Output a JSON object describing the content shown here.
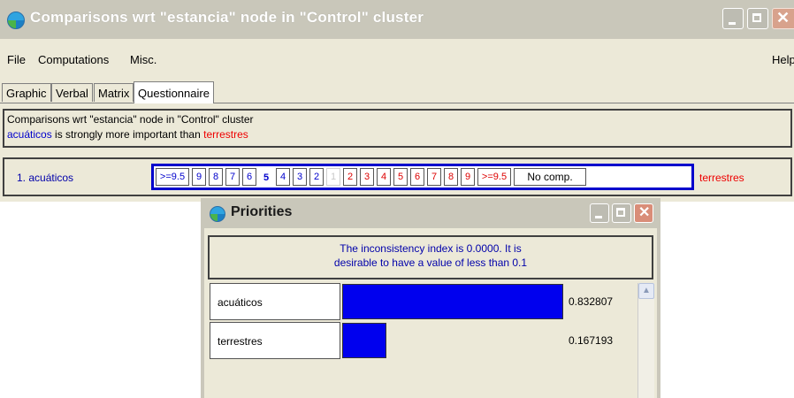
{
  "main_window": {
    "title": "Comparisons wrt \"estancia\" node in \"Control\" cluster",
    "menu": [
      "File",
      "Computations",
      "Misc.",
      "Help"
    ],
    "tabs": [
      "Graphic",
      "Verbal",
      "Matrix",
      "Questionnaire"
    ],
    "active_tab": "Questionnaire",
    "description": {
      "line1": "Comparisons wrt \"estancia\" node in \"Control\" cluster",
      "line2_left": "acuáticos",
      "line2_mid": " is strongly more important than ",
      "line2_right": "terrestres"
    },
    "question": {
      "left_label": "1.  acuáticos",
      "right_label": "terrestres",
      "scale_left": [
        ">=9.5",
        "9",
        "8",
        "7",
        "6",
        "5",
        "4",
        "3",
        "2"
      ],
      "scale_center": "1",
      "scale_right": [
        "2",
        "3",
        "4",
        "5",
        "6",
        "7",
        "8",
        "9",
        ">=9.5"
      ],
      "no_comp": "No comp.",
      "selected": "5"
    }
  },
  "priorities_window": {
    "title": "Priorities",
    "inconsistency_line1": "The inconsistency index is 0.0000.  It is",
    "inconsistency_line2": "desirable to have a value of less than 0.1",
    "rows": [
      {
        "label": "acuáticos",
        "value": "0.832807",
        "priority": 0.832807
      },
      {
        "label": "terrestres",
        "value": "0.167193",
        "priority": 0.167193
      }
    ]
  },
  "colors": {
    "accent_blue": "#0000cc",
    "accent_red": "#ee0000",
    "bar_blue": "#0000ee"
  }
}
